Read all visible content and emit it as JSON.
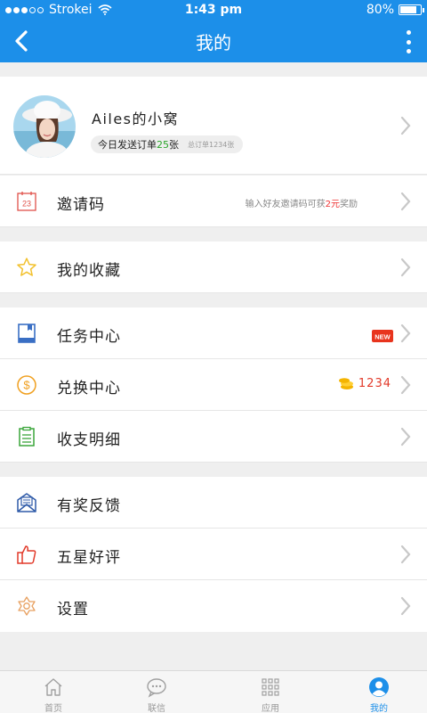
{
  "status_bar": {
    "carrier": "Strokei",
    "time": "1:43 pm",
    "battery": "80%",
    "battery_level": 0.8
  },
  "header": {
    "title": "我的"
  },
  "profile": {
    "name": "Ailes的小窝",
    "today_prefix": "今日发送订单",
    "today_count": "25",
    "today_suffix": "张",
    "total": "总订单1234张"
  },
  "invite": {
    "label": "邀请码",
    "hint_prefix": "输入好友邀请码可获",
    "hint_amount": "2元",
    "hint_suffix": "奖励"
  },
  "favorites": {
    "label": "我的收藏"
  },
  "tasks": {
    "label": "任务中心",
    "badge_text": "NEW"
  },
  "exchange": {
    "label": "兑换中心",
    "coins": "1234"
  },
  "ledger": {
    "label": "收支明细"
  },
  "feedback": {
    "label": "有奖反馈"
  },
  "rating": {
    "label": "五星好评"
  },
  "settings": {
    "label": "设置"
  },
  "tabbar": {
    "items": [
      {
        "label": "首页",
        "icon": "home-icon",
        "active": false
      },
      {
        "label": "联信",
        "icon": "chat-icon",
        "active": false
      },
      {
        "label": "应用",
        "icon": "apps-grid-icon",
        "active": false
      },
      {
        "label": "我的",
        "icon": "user-icon",
        "active": true
      }
    ]
  },
  "colors": {
    "accent": "#1c8fe9",
    "background": "#efefef",
    "coin_red": "#e23a2a",
    "green": "#2aa52a"
  }
}
